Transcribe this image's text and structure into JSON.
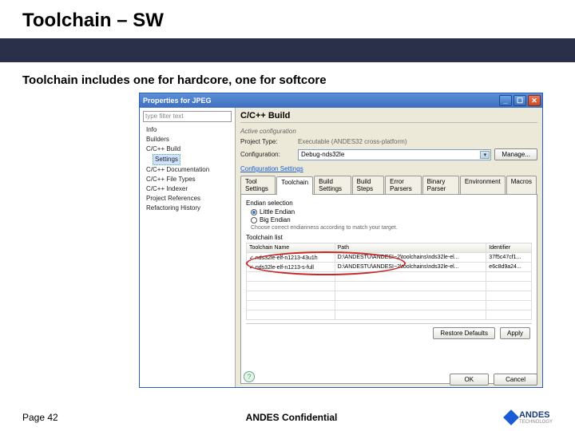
{
  "slide": {
    "title": "Toolchain – SW",
    "subtitle": "Toolchain includes one for hardcore, one for softcore"
  },
  "dialog": {
    "title": "Properties for JPEG",
    "filter_placeholder": "type filter text",
    "tree": {
      "info": "Info",
      "builders": "Builders",
      "ccbuild": "C/C++ Build",
      "settings": "Settings",
      "doc": "C/C++ Documentation",
      "file": "C/C++ File Types",
      "indexer": "C/C++ Indexer",
      "refs": "Project References",
      "refactor": "Refactoring History"
    },
    "panel_title": "C/C++ Build",
    "active_cfg_label": "Active configuration",
    "project_type_label": "Project Type:",
    "project_type_value": "Executable (ANDES32 cross-platform)",
    "config_label": "Configuration:",
    "config_value": "Debug-nds32le",
    "manage_btn": "Manage...",
    "cfg_settings_link": "Configuration Settings",
    "tabs": {
      "tool_settings": "Tool Settings",
      "toolchain": "Toolchain",
      "build_settings": "Build Settings",
      "build_steps": "Build Steps",
      "error_parsers": "Error Parsers",
      "binary_parser": "Binary Parser",
      "environment": "Environment",
      "macros": "Macros"
    },
    "endian_section": "Endian selection",
    "endian_little": "Little Endian",
    "endian_big": "Big Endian",
    "endian_hint": "Choose correct endianness according to match your target.",
    "toolchain_list": "Toolchain list",
    "cols": {
      "name": "Toolchain Name",
      "path": "Path",
      "id": "Identifier"
    },
    "rows": [
      {
        "name": "nds32le-elf-n1213-43u1h",
        "path": "D:\\ANDESTU\\ANDESI~2\\toolchains\\nds32le-el...",
        "id": "37f5c47cf1..."
      },
      {
        "name": "nds32le-elf-n1213-s-full",
        "path": "D:\\ANDESTU\\ANDESI~2\\toolchains\\nds32le-el...",
        "id": "e6c8d9a24..."
      }
    ],
    "restore": "Restore Defaults",
    "apply": "Apply",
    "ok": "OK",
    "cancel": "Cancel",
    "help": "?"
  },
  "footer": {
    "page": "Page 42",
    "conf": "ANDES Confidential",
    "brand": "ANDES",
    "brand_sub": "TECHNOLOGY"
  },
  "icons": {
    "min": "_",
    "max": "☐",
    "close": "✕",
    "caret": "▾"
  }
}
